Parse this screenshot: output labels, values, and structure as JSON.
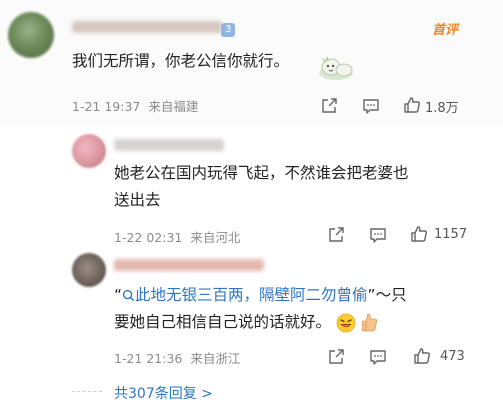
{
  "comments": [
    {
      "badge": "3",
      "tag": "首评",
      "text": "我们无所谓，你老公信你就行。",
      "time": "1-21 19:37",
      "location": "来自福建",
      "likes": "1.8万"
    },
    {
      "text_line1": "她老公在国内玩得飞起，不然谁会把老婆也",
      "text_line2": "送出去",
      "time": "1-22 02:31",
      "location": "来自河北",
      "likes": "1157"
    },
    {
      "quote_open": "“",
      "link_text": "此地无银三百两，隔壁阿二勿曾偷",
      "quote_close": "”～只",
      "text_line2": "要她自己相信自己说的话就好。",
      "time": "1-21 21:36",
      "location": "来自浙江",
      "likes": "473"
    }
  ],
  "footer": {
    "replies_label": "共307条回复 >"
  },
  "icons": [
    "share-icon",
    "comment-icon",
    "like-icon",
    "search-icon",
    "sticker-icon",
    "laugh-emoji-icon",
    "thumbs-up-emoji-icon"
  ],
  "colors": {
    "link": "#2e76c5",
    "tag": "#f5861f",
    "meta": "#8b8b8b",
    "badge": "#8fb6e0"
  }
}
